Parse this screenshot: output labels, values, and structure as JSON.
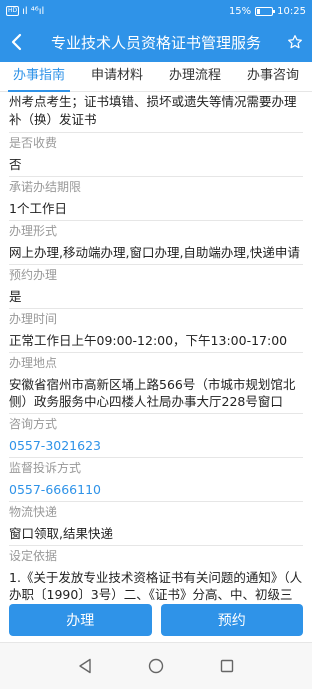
{
  "status_bar": {
    "network_badge": "HD",
    "signal_1": "ıl",
    "signal_2": "⁴⁶ıl",
    "battery": "15%",
    "time": "10:25"
  },
  "header": {
    "title": "专业技术人员资格证书管理服务"
  },
  "tabs": [
    {
      "label": "办事指南",
      "active": true
    },
    {
      "label": "申请材料",
      "active": false
    },
    {
      "label": "办理流程",
      "active": false
    },
    {
      "label": "办事咨询",
      "active": false
    }
  ],
  "content": {
    "intro_text": "州考点考生；证书填错、损坏或遗失等情况需要办理补（换）发证书",
    "fields": [
      {
        "label": "是否收费",
        "value": "否"
      },
      {
        "label": "承诺办结期限",
        "value": "1个工作日"
      },
      {
        "label": "办理形式",
        "value": "网上办理,移动端办理,窗口办理,自助端办理,快递申请"
      },
      {
        "label": "预约办理",
        "value": "是"
      },
      {
        "label": "办理时间",
        "value": "正常工作日上午09:00-12:00，下午13:00-17:00"
      },
      {
        "label": "办理地点",
        "value": "安徽省宿州市高新区埇上路566号（市城市规划馆北侧）政务服务中心四楼人社局办事大厅228号窗口"
      },
      {
        "label": "咨询方式",
        "value": "0557-3021623"
      },
      {
        "label": "监督投诉方式",
        "value": "0557-6666110"
      },
      {
        "label": "物流快递",
        "value": "窗口领取,结果快递"
      },
      {
        "label": "设定依据",
        "value": "1.《关于发放专业技术资格证书有关问题的通知》（人办职〔1990〕3号）二、《证书》分高、中、初级三"
      }
    ]
  },
  "actions": {
    "handle_label": "办理",
    "appointment_label": "预约"
  },
  "colors": {
    "accent": "#2f93e8",
    "label_gray": "#999999"
  },
  "icons": [
    "back-arrow-icon",
    "star-icon",
    "nav-back-icon",
    "nav-home-icon",
    "nav-recent-icon"
  ]
}
